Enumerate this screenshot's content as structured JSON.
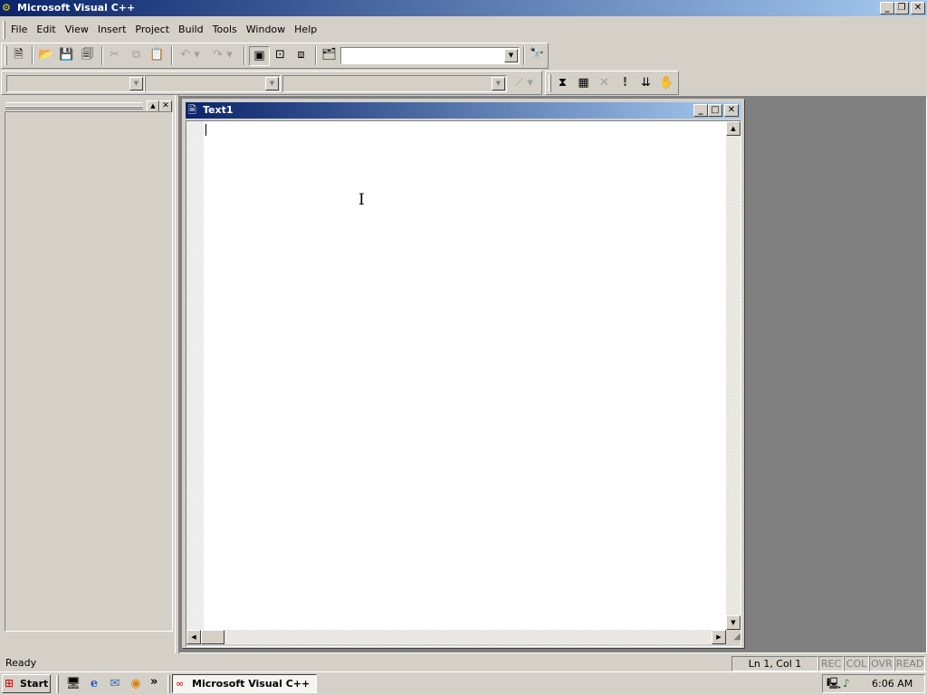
{
  "app": {
    "title": "Microsoft Visual C++",
    "colors": {
      "titlebar_start": "#0a246a",
      "titlebar_end": "#a6caf0",
      "face": "#d4d0c8",
      "workspace": "#808080"
    }
  },
  "caption_buttons": {
    "minimize": "_",
    "restore": "❐",
    "close": "✕"
  },
  "menu": [
    {
      "label": "File"
    },
    {
      "label": "Edit"
    },
    {
      "label": "View"
    },
    {
      "label": "Insert"
    },
    {
      "label": "Project"
    },
    {
      "label": "Build"
    },
    {
      "label": "Tools"
    },
    {
      "label": "Window"
    },
    {
      "label": "Help"
    }
  ],
  "toolbar": {
    "icons": [
      "new-text-file-icon",
      "open-folder-icon",
      "save-icon",
      "save-all-icon",
      "cut-icon",
      "copy-icon",
      "paste-icon",
      "undo-icon",
      "redo-icon",
      "workspace-icon",
      "output-icon",
      "window-list-icon",
      "find-in-files-icon",
      "find-icon"
    ],
    "find_combo_value": ""
  },
  "wizardbar": {
    "class_combo_value": "",
    "filter_combo_value": "",
    "members_combo_value": "",
    "icons": [
      "wizard-action-icon",
      "compile-icon",
      "build-icon",
      "stop-build-icon",
      "execute-icon",
      "go-icon",
      "breakpoint-icon"
    ]
  },
  "workspace_pane": {
    "icons": [
      "pane-maximize-icon",
      "pane-close-icon"
    ]
  },
  "document": {
    "title": "Text1",
    "content": ""
  },
  "status_bar": {
    "message": "Ready",
    "position": "Ln 1, Col 1",
    "indicators": [
      "REC",
      "COL",
      "OVR",
      "READ"
    ]
  },
  "taskbar": {
    "start_label": "Start",
    "quick_launch": [
      "show-desktop-icon",
      "internet-explorer-icon",
      "outlook-express-icon",
      "media-player-icon"
    ],
    "overflow": "»",
    "task_label": "Microsoft Visual C++",
    "clock": "6:06 AM"
  }
}
